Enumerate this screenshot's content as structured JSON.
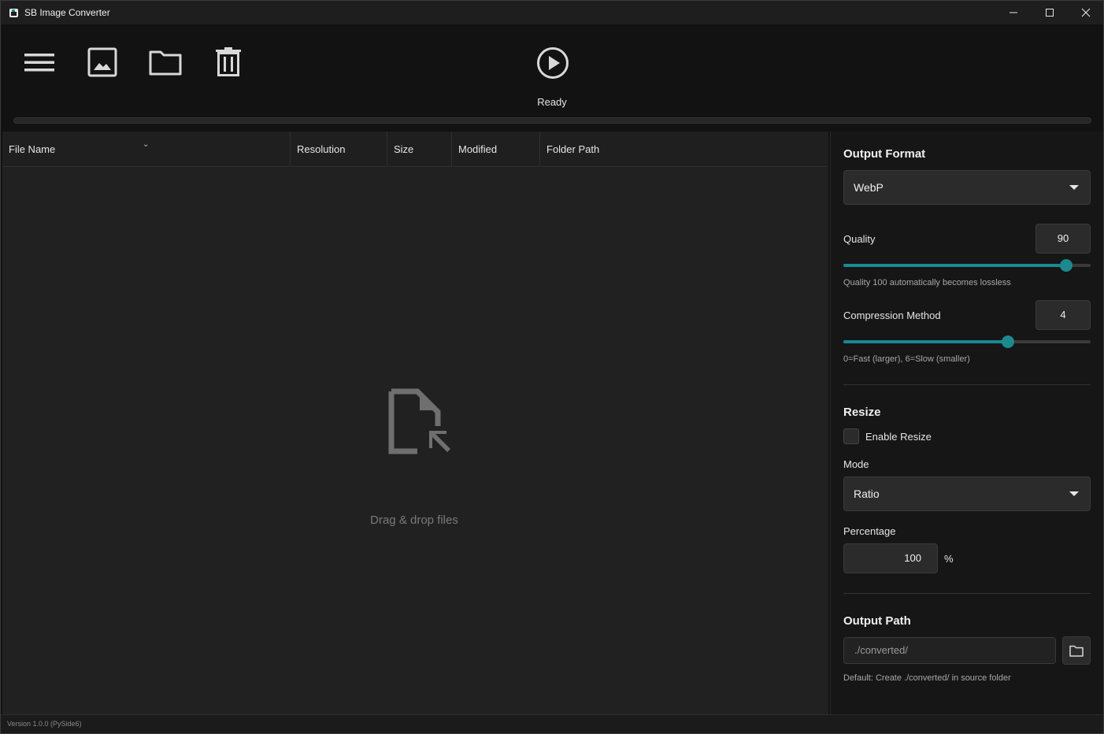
{
  "window": {
    "title": "SB Image Converter",
    "minimize_icon": "minimize-icon",
    "maximize_icon": "maximize-icon",
    "close_icon": "close-icon"
  },
  "toolbar": {
    "menu_icon": "hamburger-menu-icon",
    "add_images_icon": "image-icon",
    "add_folder_icon": "folder-icon",
    "clear_icon": "trash-icon",
    "start_icon": "play-icon",
    "status": "Ready",
    "progress": 0
  },
  "file_table": {
    "columns": [
      "File Name",
      "Resolution",
      "Size",
      "Modified",
      "Folder Path"
    ],
    "sort_indicator": "⌄",
    "rows": [],
    "drop_icon": "file-drop-icon",
    "drop_text": "Drag & drop files"
  },
  "settings": {
    "output_format": {
      "heading": "Output Format",
      "value": "WebP"
    },
    "quality": {
      "label": "Quality",
      "value": "90",
      "min": 0,
      "max": 100,
      "hint": "Quality 100 automatically becomes lossless"
    },
    "compression": {
      "label": "Compression Method",
      "value": "4",
      "min": 0,
      "max": 6,
      "hint": "0=Fast (larger), 6=Slow (smaller)"
    },
    "resize": {
      "heading": "Resize",
      "enable_label": "Enable Resize",
      "enabled": false,
      "mode_label": "Mode",
      "mode_value": "Ratio",
      "percentage_label": "Percentage",
      "percentage_value": "100",
      "percent_sign": "%"
    },
    "output_path": {
      "heading": "Output Path",
      "placeholder": "./converted/",
      "hint": "Default: Create ./converted/ in source folder",
      "browse_icon": "folder-icon"
    }
  },
  "status_bar": {
    "version": "Version 1.0.0 (PySide6)"
  },
  "colors": {
    "accent": "#1a8a8f",
    "background": "#121212",
    "panel": "#212121"
  }
}
